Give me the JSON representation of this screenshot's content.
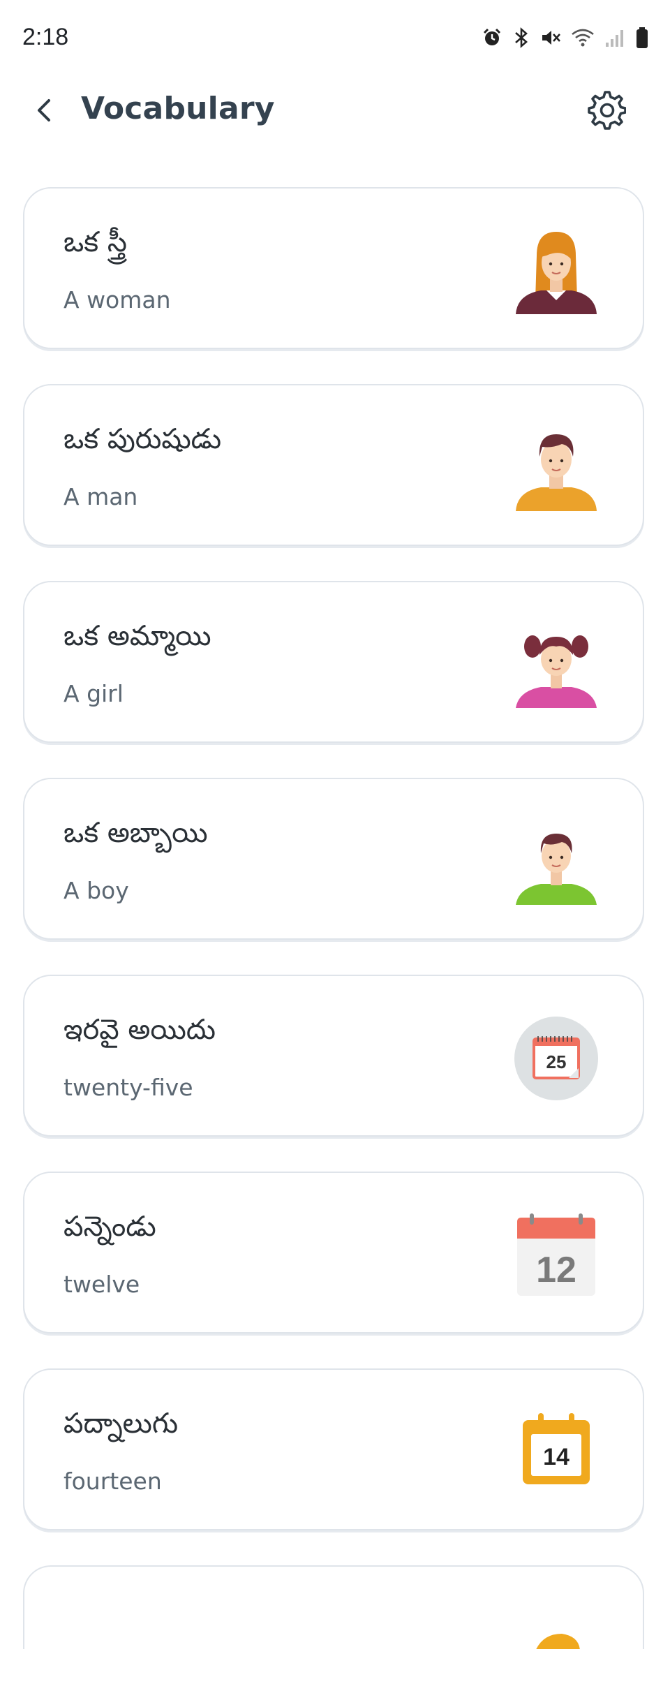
{
  "status_bar": {
    "time": "2:18",
    "icons": [
      "alarm-icon",
      "bluetooth-icon",
      "mute-icon",
      "wifi-icon",
      "signal-icon",
      "battery-icon"
    ]
  },
  "header": {
    "title": "Vocabulary",
    "back_icon": "chevron-left-icon",
    "settings_icon": "gear-icon"
  },
  "vocab_items": [
    {
      "native": "ఒక స్త్రీ",
      "english": "A woman",
      "image": "woman-avatar"
    },
    {
      "native": "ఒక పురుషుడు",
      "english": "A man",
      "image": "man-avatar"
    },
    {
      "native": "ఒక అమ్మాయి",
      "english": "A girl",
      "image": "girl-avatar"
    },
    {
      "native": "ఒక అబ్బాయి",
      "english": "A boy",
      "image": "boy-avatar"
    },
    {
      "native": "ఇరవై అయిదు",
      "english": "twenty-five",
      "image": "calendar-25-icon",
      "number": "25"
    },
    {
      "native": "పన్నెండు",
      "english": "twelve",
      "image": "calendar-12-icon",
      "number": "12"
    },
    {
      "native": "పద్నాలుగు",
      "english": "fourteen",
      "image": "calendar-14-icon",
      "number": "14"
    }
  ],
  "colors": {
    "title": "#34424f",
    "card_border": "#dfe4ea",
    "english_text": "#5b6772",
    "calendar_red": "#f0705f",
    "calendar_yellow": "#f0a91e"
  }
}
